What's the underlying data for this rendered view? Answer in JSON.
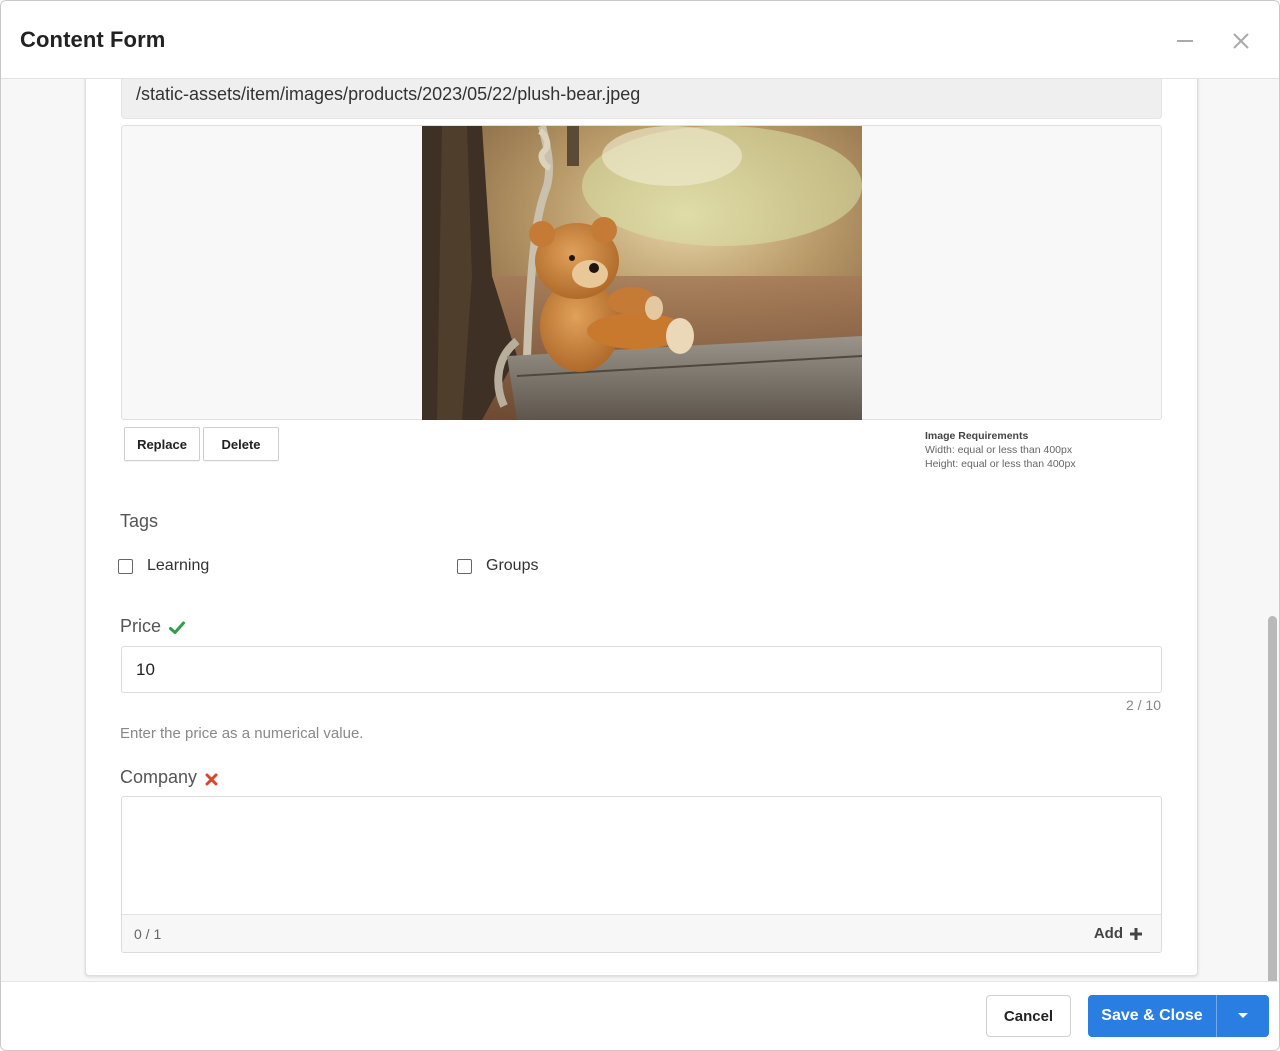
{
  "window": {
    "title": "Content Form",
    "minimize_icon": "minimize-icon",
    "close_icon": "close-icon"
  },
  "image_field": {
    "path": "/static-assets/item/images/products/2023/05/22/plush-bear.jpeg",
    "image_alt": "Teddy bear sitting on a wooden swing",
    "replace_label": "Replace",
    "delete_label": "Delete",
    "requirements": {
      "title": "Image Requirements",
      "width": "Width: equal or less than 400px",
      "height": "Height: equal or less than 400px"
    }
  },
  "tags": {
    "label": "Tags",
    "options": [
      {
        "label": "Learning",
        "checked": false
      },
      {
        "label": "Groups",
        "checked": false
      }
    ]
  },
  "price": {
    "label": "Price",
    "status_icon": "check-icon",
    "status_color": "#2e9e4b",
    "value": "10",
    "counter": "2 / 10",
    "help": "Enter the price as a numerical value."
  },
  "company": {
    "label": "Company",
    "status_icon": "x-icon",
    "status_color": "#d9452f",
    "count": "0 / 1",
    "add_label": "Add",
    "add_icon": "plus-icon"
  },
  "footer": {
    "cancel_label": "Cancel",
    "save_label": "Save & Close",
    "save_color": "#2a7de1",
    "dropdown_icon": "caret-down-icon"
  }
}
